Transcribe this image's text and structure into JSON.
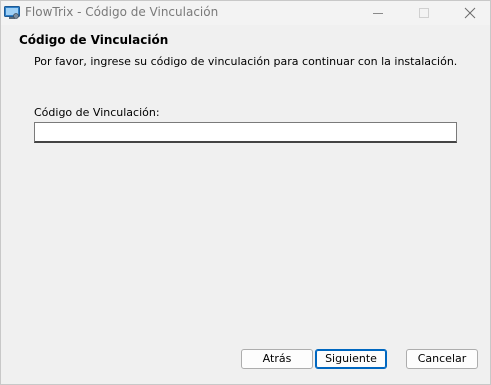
{
  "window": {
    "title": "FlowTrix - Código de Vinculación",
    "app_icon": "installer-app-icon"
  },
  "titlebar_controls": {
    "minimize_icon": "minimize-icon",
    "maximize_icon": "maximize-icon",
    "close_icon": "close-icon"
  },
  "header": {
    "title": "Código de Vinculación",
    "subtitle": "Por favor, ingrese su código de vinculación para continuar con la instalación."
  },
  "form": {
    "code_label": "Código de Vinculación:",
    "code_value": "",
    "code_placeholder": ""
  },
  "buttons": {
    "back_label": "Atrás",
    "next_label": "Siguiente",
    "cancel_label": "Cancelar"
  },
  "colors": {
    "accent": "#0067c0",
    "window_bg": "#f0f0f0"
  }
}
